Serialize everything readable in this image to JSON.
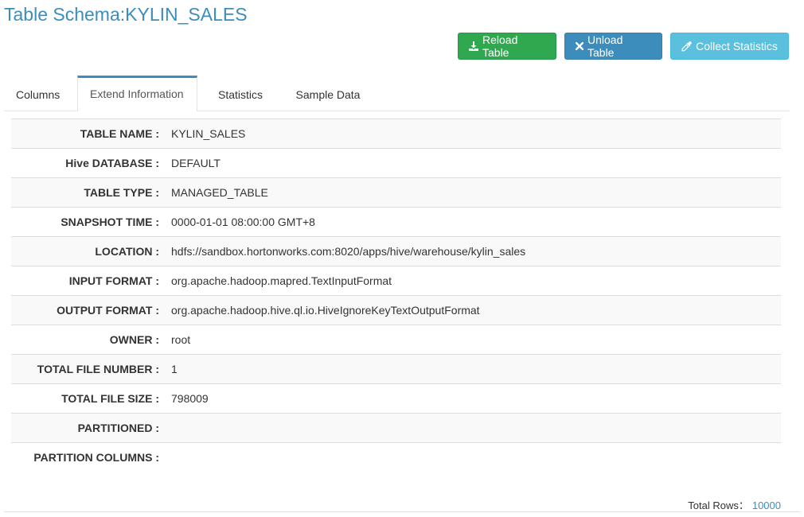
{
  "page": {
    "title": "Table Schema:KYLIN_SALES"
  },
  "toolbar": {
    "reload_label": "Reload Table",
    "unload_label": "Unload Table",
    "collect_label": "Collect Statistics",
    "reload_icon": "download-icon",
    "unload_icon": "close-icon",
    "collect_icon": "eyedropper-icon",
    "colors": {
      "reload": "#2fa84f",
      "unload": "#3c8dbc",
      "collect": "#5bc0de"
    }
  },
  "tabs": [
    {
      "label": "Columns",
      "active": false
    },
    {
      "label": "Extend Information",
      "active": true
    },
    {
      "label": "Statistics",
      "active": false
    },
    {
      "label": "Sample Data",
      "active": false
    }
  ],
  "info": [
    {
      "label": "TABLE NAME :",
      "value": "KYLIN_SALES"
    },
    {
      "label": "Hive DATABASE :",
      "value": "DEFAULT"
    },
    {
      "label": "TABLE TYPE :",
      "value": "MANAGED_TABLE"
    },
    {
      "label": "SNAPSHOT TIME :",
      "value": "0000-01-01 08:00:00 GMT+8"
    },
    {
      "label": "LOCATION :",
      "value": "hdfs://sandbox.hortonworks.com:8020/apps/hive/warehouse/kylin_sales"
    },
    {
      "label": "INPUT FORMAT :",
      "value": "org.apache.hadoop.mapred.TextInputFormat"
    },
    {
      "label": "OUTPUT FORMAT :",
      "value": "org.apache.hadoop.hive.ql.io.HiveIgnoreKeyTextOutputFormat"
    },
    {
      "label": "OWNER :",
      "value": "root"
    },
    {
      "label": "TOTAL FILE NUMBER :",
      "value": "1"
    },
    {
      "label": "TOTAL FILE SIZE :",
      "value": "798009"
    },
    {
      "label": "PARTITIONED :",
      "value": ""
    },
    {
      "label": "PARTITION COLUMNS :",
      "value": ""
    }
  ],
  "footer": {
    "total_rows_label": "Total Rows：",
    "total_rows_value": "10000"
  }
}
